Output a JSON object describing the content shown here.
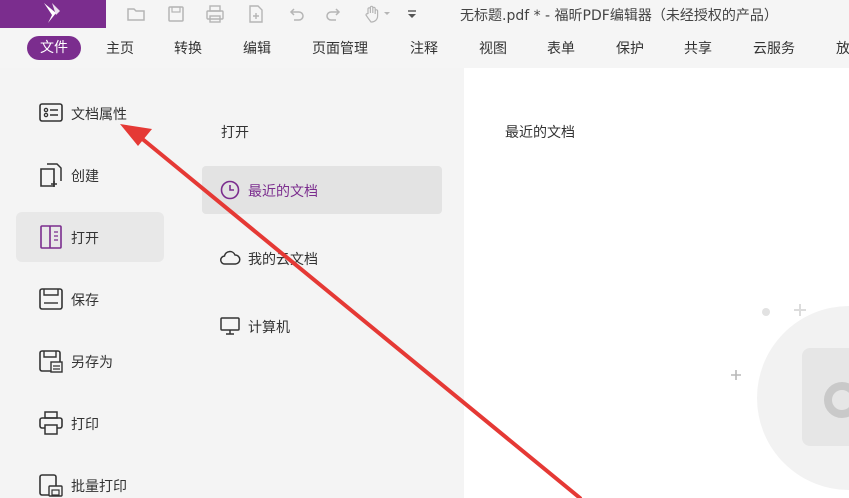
{
  "app": {
    "window_title": "无标题.pdf * - 福昕PDF编辑器（未经授权的产品）",
    "brand_color": "#7b2d8e",
    "quick_access_icons": [
      "folder-icon",
      "save-icon",
      "print-icon",
      "new-file-icon",
      "undo-icon",
      "redo-icon",
      "hand-tool-icon",
      "dropdown-icon",
      "customize-icon"
    ]
  },
  "menu": {
    "items": [
      "文件",
      "主页",
      "转换",
      "编辑",
      "页面管理",
      "注释",
      "视图",
      "表单",
      "保护",
      "共享",
      "云服务",
      "放"
    ],
    "active": "文件"
  },
  "sidebar": {
    "items": [
      {
        "label": "文档属性",
        "icon": "document-properties-icon"
      },
      {
        "label": "创建",
        "icon": "create-document-icon"
      },
      {
        "label": "打开",
        "icon": "open-book-icon"
      },
      {
        "label": "保存",
        "icon": "save-icon"
      },
      {
        "label": "另存为",
        "icon": "save-as-icon"
      },
      {
        "label": "打印",
        "icon": "printer-icon"
      },
      {
        "label": "批量打印",
        "icon": "batch-print-icon"
      }
    ],
    "active": "打开"
  },
  "open_panel": {
    "heading": "打开",
    "items": [
      {
        "label": "最近的文档",
        "icon": "clock-icon"
      },
      {
        "label": "我的云文档",
        "icon": "cloud-icon"
      },
      {
        "label": "计算机",
        "icon": "computer-icon"
      }
    ],
    "active": "最近的文档"
  },
  "content": {
    "heading": "最近的文档"
  },
  "annotation": {
    "arrow_color": "#e53935"
  }
}
